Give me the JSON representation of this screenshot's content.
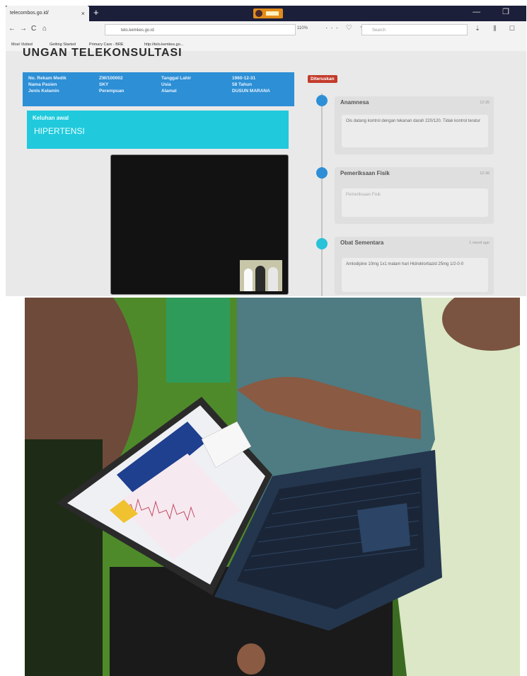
{
  "browser": {
    "tab_title": "telecombos.go.id/",
    "new_tab_glyph": "+",
    "window_controls": "— ❐",
    "nav_icons": {
      "back": "←",
      "forward": "→",
      "reload": "C",
      "home": "⌂"
    },
    "url": "telo.kemkes.go.id",
    "zoom": "110%",
    "page_action_icons": "··· ♡ ★",
    "search_placeholder": "Search",
    "right_icons": "⇣ ⫼ ☐",
    "bookmarks": [
      "Most Visited",
      "Getting Started",
      "Primary Care - BRE",
      "http://telo.kemkes.go..."
    ]
  },
  "page": {
    "heading_partial": "UNGAN TELEKONSULTASI",
    "patient": {
      "col1_labels": [
        "No. Rekam Medik",
        "Nama Pasien",
        "Jenis Kelamin"
      ],
      "col2_values": [
        "ZW/100002",
        "SKY",
        "Perempuan"
      ],
      "col3_labels": [
        "Tanggal Lahir",
        "Usia",
        "Alamat"
      ],
      "col4_values": [
        "1960-12-31",
        "58 Tahun",
        "DUSUN MARANA"
      ]
    },
    "diagnosis_label": "Keluhan awal",
    "diagnosis_value": "HIPERTENSI",
    "status_badge": "Diteruskan",
    "timeline": [
      {
        "title": "Anamnesa",
        "time": "12:35",
        "body": "Ois datang kontrol dengan tekanan darah 220/120. Tidak kontrol teratur",
        "color": "#2f8fd6"
      },
      {
        "title": "Pemeriksaan Fisik",
        "time": "12:36",
        "body": "Pemeriksaan Fisik",
        "color": "#2f8fd6"
      },
      {
        "title": "Obat Sementara",
        "time": "1 menit ago",
        "body": "Amlodipine 10mg 1x1 malam hari Hidroklortiazid 25mg 1/2-0-0",
        "color": "#29c2d8"
      }
    ]
  }
}
